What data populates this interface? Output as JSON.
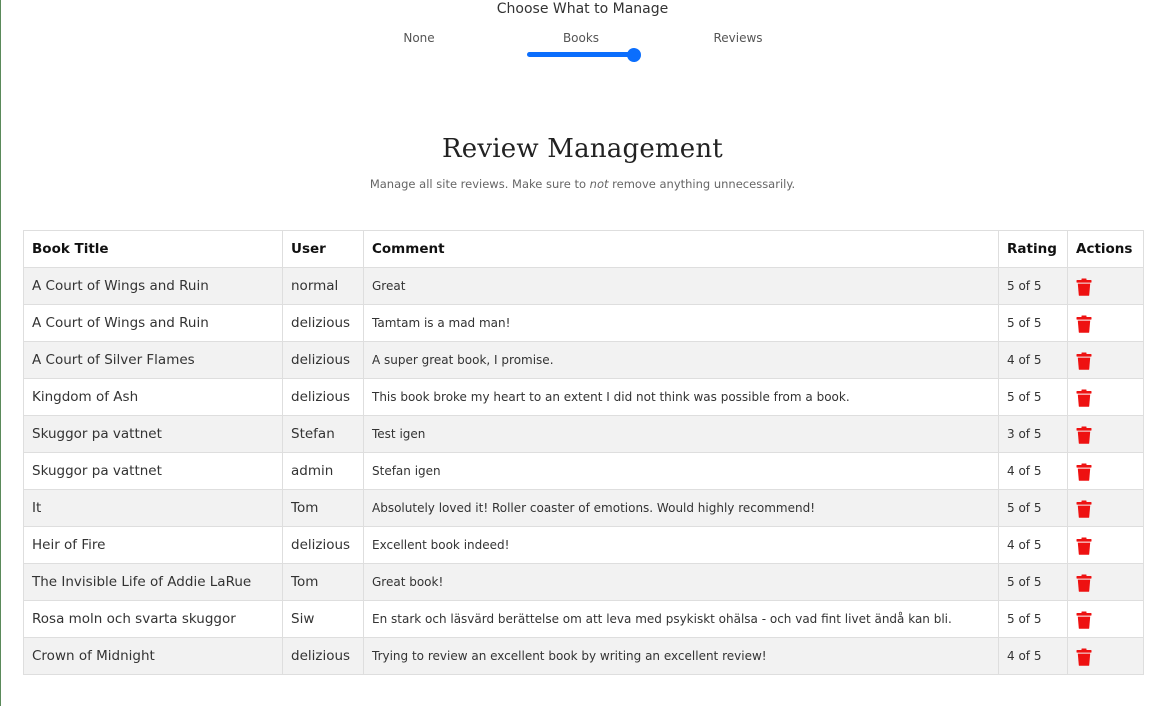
{
  "manage": {
    "title": "Choose What to Manage",
    "options": [
      "None",
      "Books",
      "Reviews"
    ],
    "selected": "Books"
  },
  "page": {
    "title": "Review Management",
    "subtitle_before": "Manage all site reviews. Make sure to ",
    "subtitle_emphasis": "not",
    "subtitle_after": " remove anything unnecessarily."
  },
  "table": {
    "headers": [
      "Book Title",
      "User",
      "Comment",
      "Rating",
      "Actions"
    ],
    "rows": [
      {
        "book": "A Court of Wings and Ruin",
        "user": "normal",
        "comment": "Great",
        "rating": "5 of 5"
      },
      {
        "book": "A Court of Wings and Ruin",
        "user": "delizious",
        "comment": "Tamtam is a mad man!",
        "rating": "5 of 5"
      },
      {
        "book": "A Court of Silver Flames",
        "user": "delizious",
        "comment": "A super great book, I promise.",
        "rating": "4 of 5"
      },
      {
        "book": "Kingdom of Ash",
        "user": "delizious",
        "comment": "This book broke my heart to an extent I did not think was possible from a book.",
        "rating": "5 of 5"
      },
      {
        "book": "Skuggor pa vattnet",
        "user": "Stefan",
        "comment": "Test igen",
        "rating": "3 of 5"
      },
      {
        "book": "Skuggor pa vattnet",
        "user": "admin",
        "comment": "Stefan igen",
        "rating": "4 of 5"
      },
      {
        "book": "It",
        "user": "Tom",
        "comment": "Absolutely loved it! Roller coaster of emotions. Would highly recommend!",
        "rating": "5 of 5"
      },
      {
        "book": "Heir of Fire",
        "user": "delizious",
        "comment": "Excellent book indeed!",
        "rating": "4 of 5"
      },
      {
        "book": "The Invisible Life of Addie LaRue",
        "user": "Tom",
        "comment": "Great book!",
        "rating": "5 of 5"
      },
      {
        "book": "Rosa moln och svarta skuggor",
        "user": "Siw",
        "comment": "En stark och läsvärd berättelse om att leva med psykiskt ohälsa - och vad fint livet ändå kan bli.",
        "rating": "5 of 5"
      },
      {
        "book": "Crown of Midnight",
        "user": "delizious",
        "comment": "Trying to review an excellent book by writing an excellent review!",
        "rating": "4 of 5"
      }
    ]
  },
  "icons": {
    "delete": "trash-icon"
  },
  "colors": {
    "accent": "#0b6efd",
    "delete": "#ee1111"
  }
}
